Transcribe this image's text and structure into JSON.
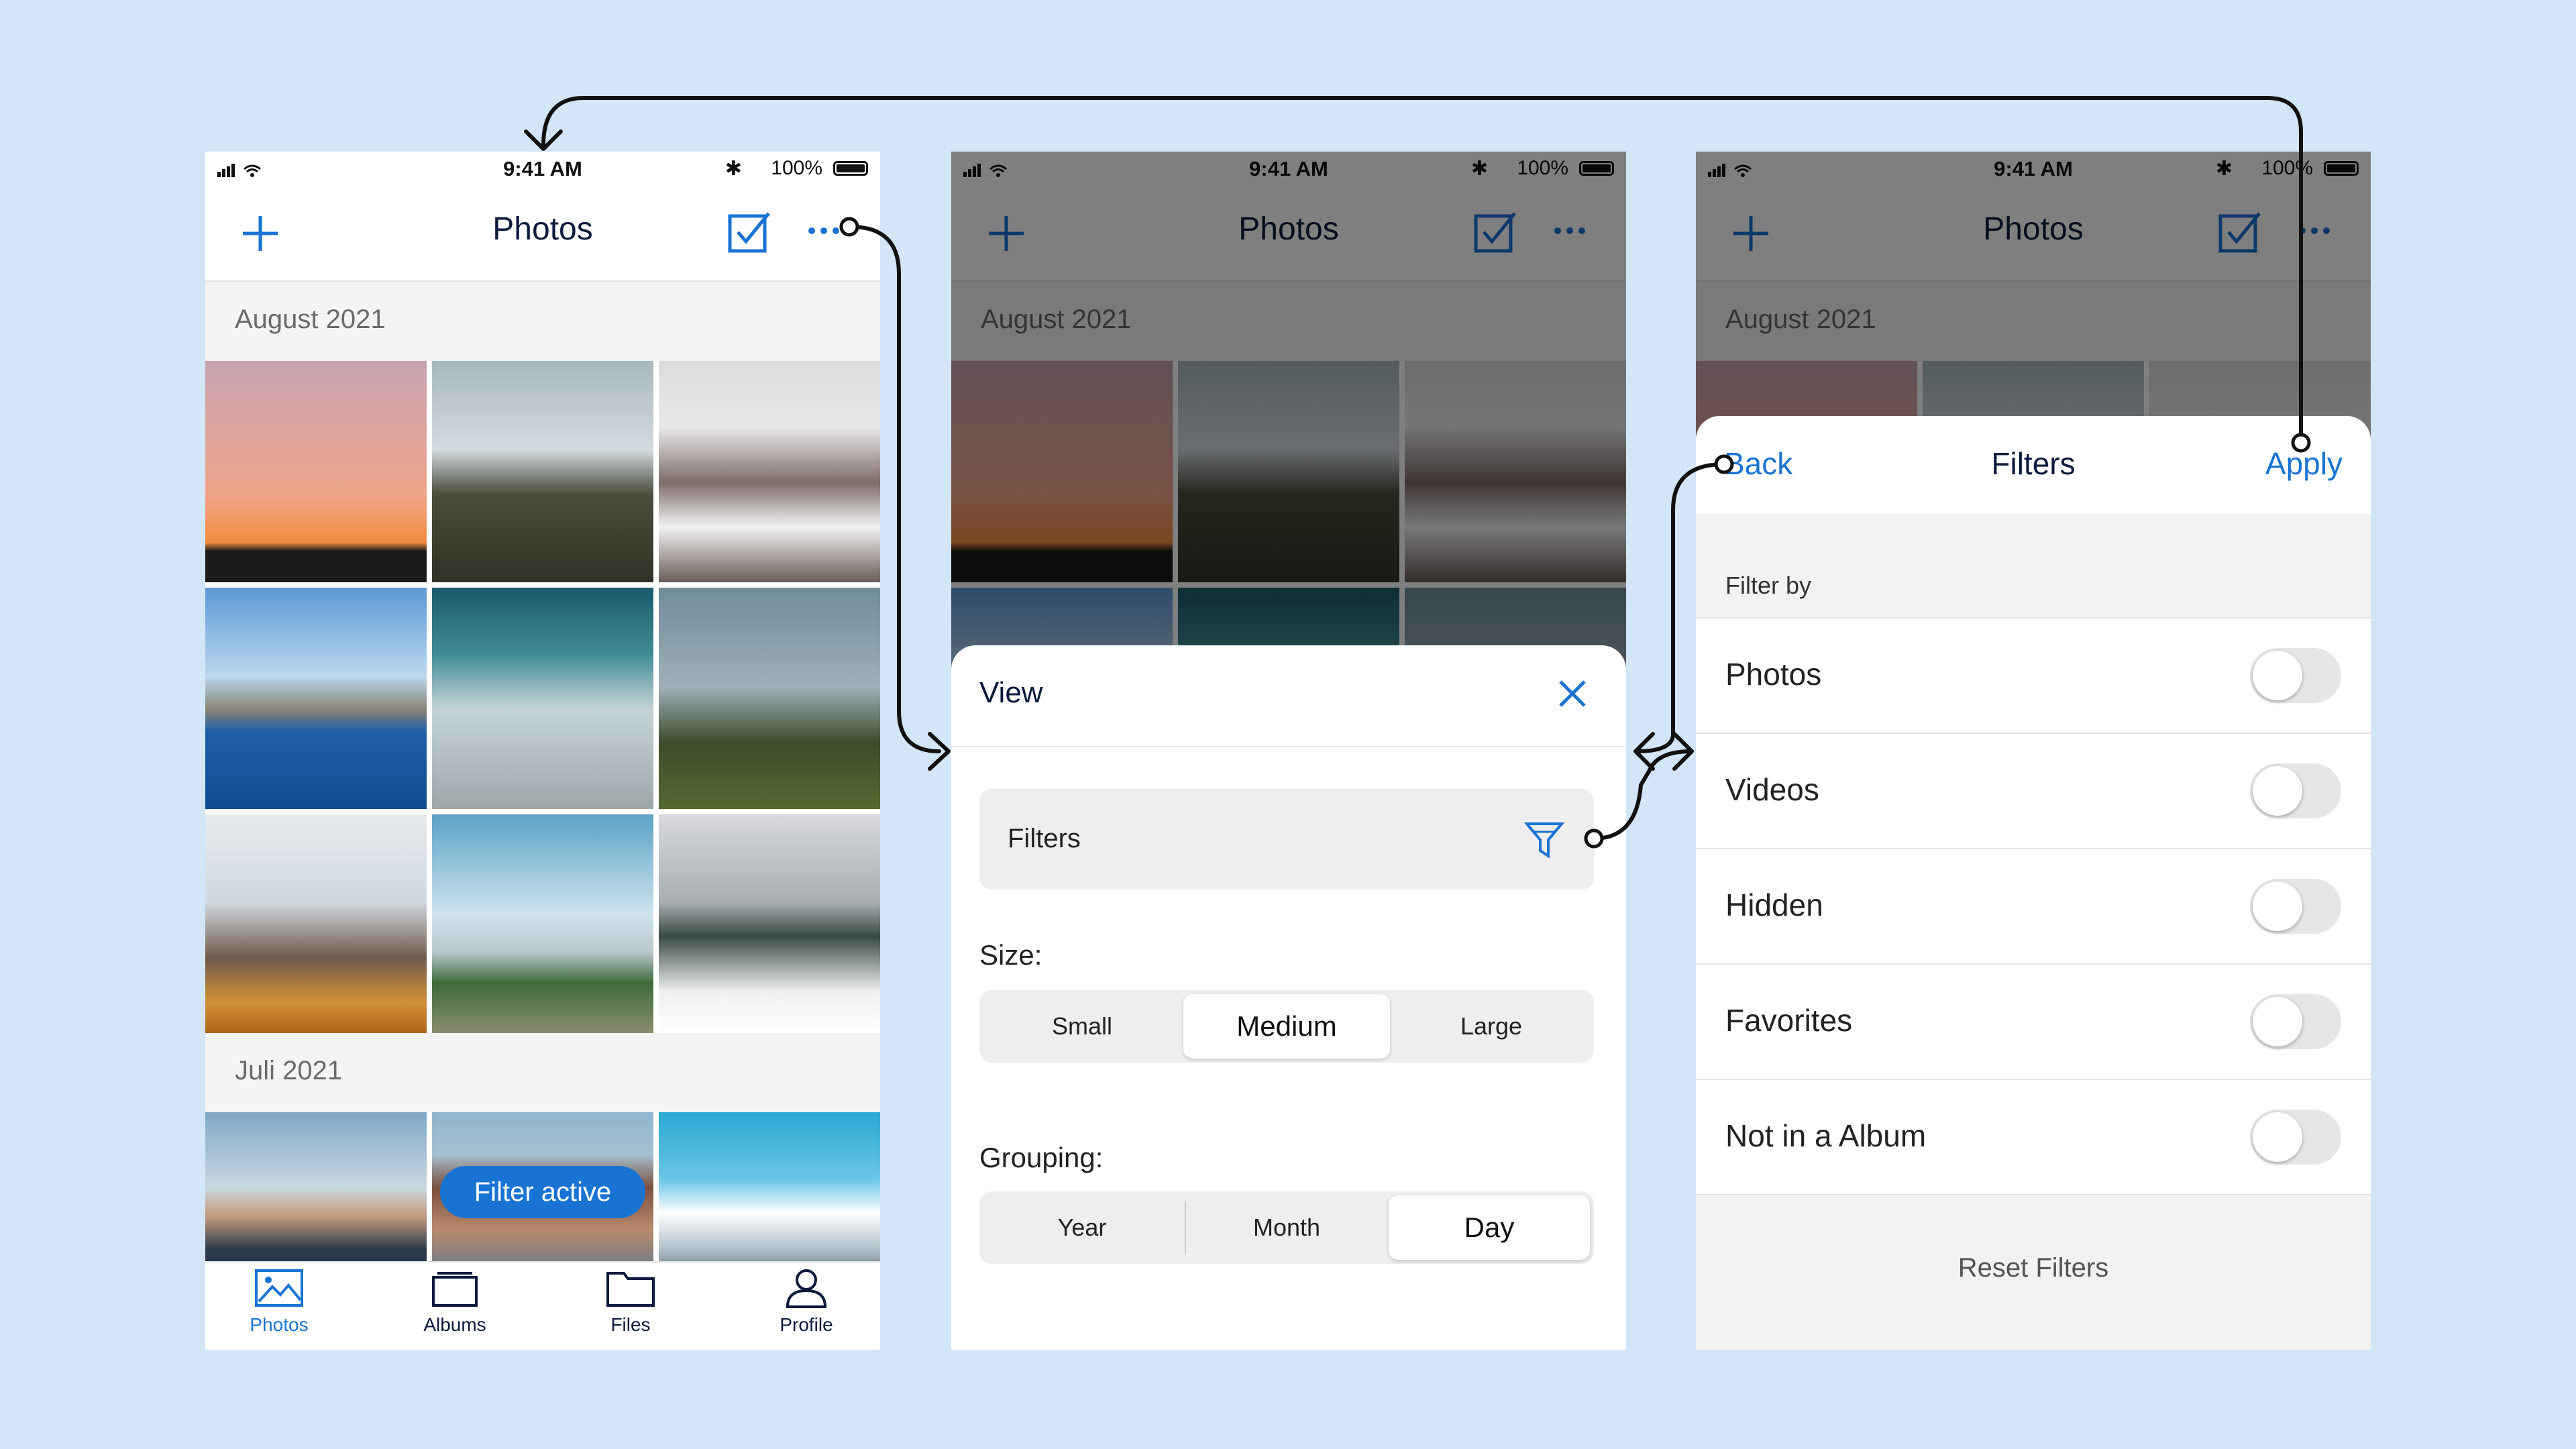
{
  "colors": {
    "accent": "#1873d3",
    "background": "#d2e6f8",
    "nav_text": "#0a1a3d"
  },
  "status": {
    "time": "9:41 AM",
    "battery": "100%"
  },
  "nav": {
    "title": "Photos",
    "add_icon": "plus-icon",
    "select_icon": "checkbox-icon",
    "more_icon": "more-dots-icon"
  },
  "sections": {
    "august": "August 2021",
    "july": "Juli 2021"
  },
  "pill": {
    "label": "Filter active"
  },
  "tabs": [
    {
      "label": "Photos",
      "icon": "image-icon"
    },
    {
      "label": "Albums",
      "icon": "album-icon"
    },
    {
      "label": "Files",
      "icon": "folder-icon"
    },
    {
      "label": "Profile",
      "icon": "person-icon"
    }
  ],
  "view_sheet": {
    "title": "View",
    "filters_label": "Filters",
    "size_label": "Size:",
    "size_options": [
      "Small",
      "Medium",
      "Large"
    ],
    "size_selected": "Medium",
    "grouping_label": "Grouping:",
    "grouping_options": [
      "Year",
      "Month",
      "Day"
    ],
    "grouping_selected": "Day"
  },
  "filter_sheet": {
    "back": "Back",
    "title": "Filters",
    "apply": "Apply",
    "filter_by": "Filter by",
    "items": [
      "Photos",
      "Videos",
      "Hidden",
      "Favorites",
      "Not in a Album"
    ],
    "reset": "Reset Filters"
  }
}
